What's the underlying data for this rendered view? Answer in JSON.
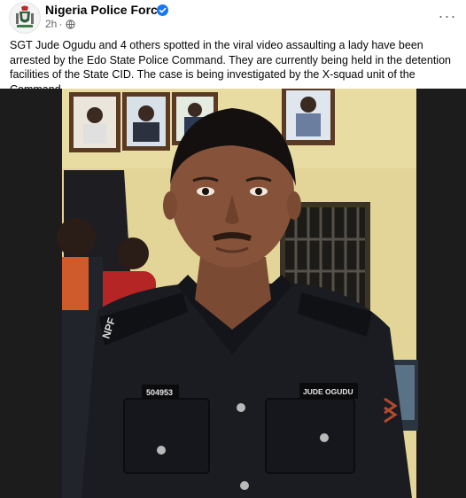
{
  "post": {
    "page_name": "Nigeria Police Force",
    "timestamp": "2h",
    "separator": "·",
    "audience_icon": "globe-icon",
    "verified_icon": "verified-badge-icon",
    "more_icon": "more-options-icon",
    "more_label": "···",
    "caption": "SGT Jude Ogudu and 4 others spotted in the viral video assaulting a lady have been arrested by the Edo State Police Command. They are currently being held in the detention facilities of the State CID. The case is being investigated by the X-squad unit of the Command.",
    "photo": {
      "shoulder_badge_text": "NPF",
      "number_tag_text": "504953",
      "name_tag_text": "JUDE OGUDU"
    }
  },
  "colors": {
    "verified_blue": "#1877f2",
    "secondary_text": "#65676b",
    "wall_yellow": "#e8d99a"
  }
}
